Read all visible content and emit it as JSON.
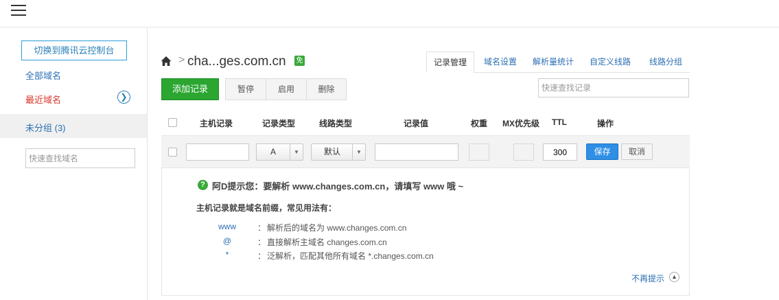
{
  "sidebar": {
    "switch_button": "切换到腾讯云控制台",
    "all_domains": "全部域名",
    "recent_domains": "最近域名",
    "ungrouped": "未分组 (3)",
    "search_placeholder": "快速查找域名"
  },
  "header": {
    "domain": "cha...ges.com.cn",
    "free_badge": "免"
  },
  "tabs": [
    "记录管理",
    "域名设置",
    "解析量统计",
    "自定义线路",
    "线路分组"
  ],
  "toolbar": {
    "add": "添加记录",
    "pause": "暂停",
    "enable": "启用",
    "delete": "删除",
    "search_placeholder": "快速查找记录"
  },
  "columns": [
    "主机记录",
    "记录类型",
    "线路类型",
    "记录值",
    "权重",
    "MX优先级",
    "TTL",
    "操作"
  ],
  "edit_row": {
    "host": "",
    "type": "A",
    "line": "默认",
    "value": "",
    "ttl": "300",
    "save": "保存",
    "cancel": "取消"
  },
  "tip": {
    "title": "阿D提示您：要解析 www.changes.com.cn，请填写 www 哦 ~",
    "subtitle": "主机记录就是域名前缀，常见用法有：",
    "examples": [
      {
        "key": "www",
        "desc": "解析后的域名为 www.changes.com.cn"
      },
      {
        "key": "@",
        "desc": "直接解析主域名 changes.com.cn"
      },
      {
        "key": "*",
        "desc": "泛解析，匹配其他所有域名 *.changes.com.cn"
      }
    ],
    "colon": "：",
    "dont_show": "不再提示"
  },
  "colors": {
    "accent_blue": "#2c6fb3",
    "add_green": "#2aa631",
    "recent_red": "#d9362b",
    "save_blue": "#2f8ee6"
  }
}
